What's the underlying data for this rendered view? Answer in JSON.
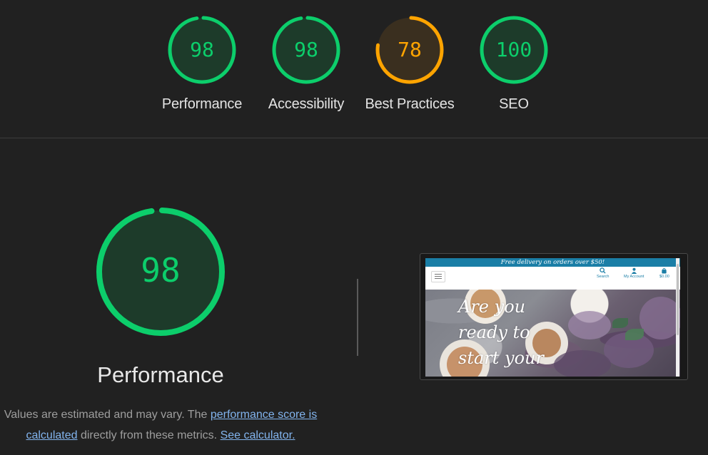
{
  "categories": [
    {
      "id": "performance",
      "label": "Performance",
      "score": 98,
      "color": "#0cce6b",
      "fill": "#1d3b2a"
    },
    {
      "id": "accessibility",
      "label": "Accessibility",
      "score": 98,
      "color": "#0cce6b",
      "fill": "#1d3b2a"
    },
    {
      "id": "best-practices",
      "label": "Best Practices",
      "score": 78,
      "color": "#ffa400",
      "fill": "#3a2f1f"
    },
    {
      "id": "seo",
      "label": "SEO",
      "score": 100,
      "color": "#0cce6b",
      "fill": "#1d3b2a"
    }
  ],
  "main": {
    "title": "Performance",
    "score": 98,
    "color": "#0cce6b",
    "fill": "#1d3b2a",
    "description": {
      "prefix": "Values are estimated and may vary. The ",
      "link1": "performance score is calculated",
      "middle": " directly from these metrics. ",
      "link2": "See calculator."
    }
  },
  "screenshot": {
    "promo": "Free delivery on orders over $50!",
    "nav": {
      "search": "Search",
      "account": "My Account",
      "cart": "$0.00"
    },
    "hero_lines": [
      "Are you",
      "ready to",
      "start your"
    ]
  }
}
